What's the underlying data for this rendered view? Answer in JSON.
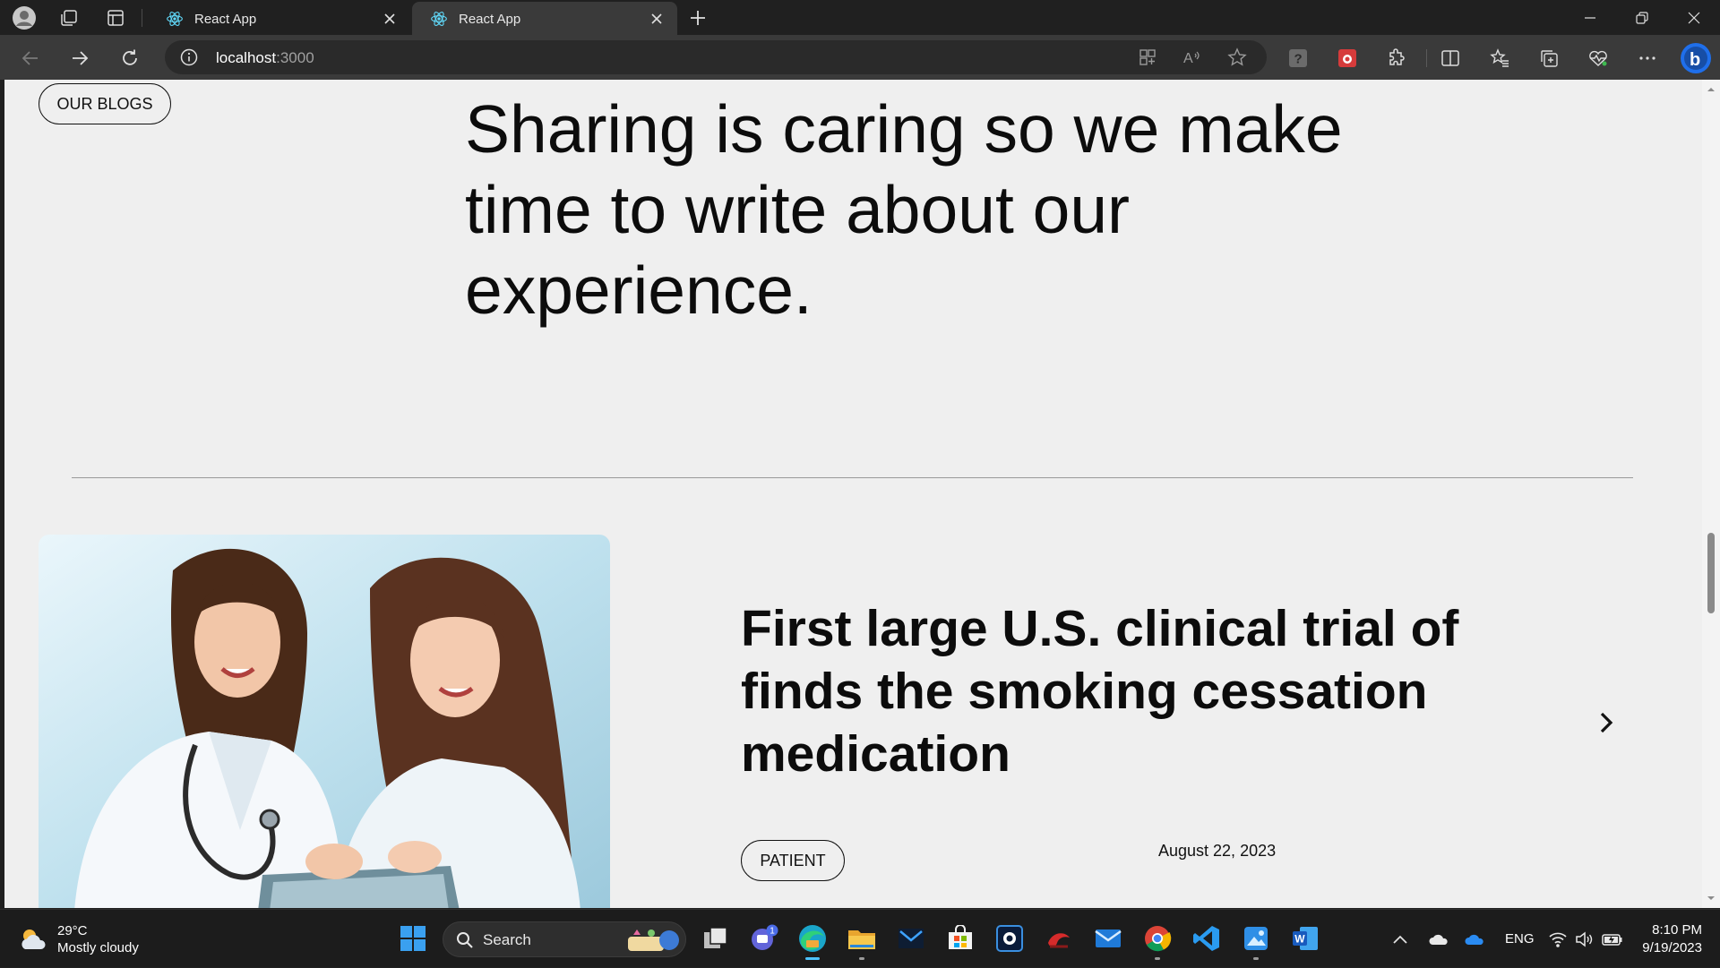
{
  "browser": {
    "tabs": [
      {
        "title": "React App",
        "active": false
      },
      {
        "title": "React App",
        "active": true
      }
    ],
    "address": {
      "host": "localhost",
      "port": ":3000"
    }
  },
  "page": {
    "section_tag": "OUR BLOGS",
    "headline": "Sharing is caring so we make time to write about our experience.",
    "post": {
      "title": "First large U.S. clinical trial of finds the smoking cessation medication",
      "category": "PATIENT",
      "date": "August 22, 2023"
    }
  },
  "taskbar": {
    "weather": {
      "temp": "29°C",
      "condition": "Mostly cloudy"
    },
    "search_label": "Search",
    "teams_badge": "1",
    "language": "ENG",
    "time": "8:10 PM",
    "date": "9/19/2023"
  },
  "colors": {
    "page_bg": "#efefef",
    "titlebar_bg": "#202020",
    "toolbar_bg": "#3a3a3a",
    "taskbar_bg": "#1c1c1c",
    "accent": "#4cc2ff"
  }
}
